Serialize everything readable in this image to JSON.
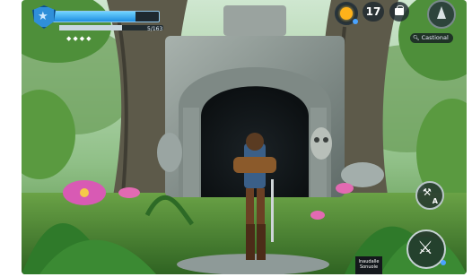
{
  "hud": {
    "health": {
      "fill_fraction": 0.78,
      "color": "#2f8fd9"
    },
    "stamina": {
      "text": "5/163",
      "fill_fraction": 0.6
    },
    "pips": "◆◆◆◆",
    "level": "17",
    "location_label": "Castional",
    "action_button_label": "A",
    "bottom_tag": "Inaudalle Sonuole"
  },
  "icons": {
    "shield": "shield-icon",
    "sun": "sun-icon",
    "bag": "bag-icon",
    "compass": "compass-icon",
    "search": "search-icon",
    "lever": "lever-icon",
    "sword": "sword-icon"
  },
  "colors": {
    "accent": "#2f8fd9",
    "sun": "#ffb21a",
    "foliage": "#3f7f2e",
    "stone": "#8a9490"
  }
}
